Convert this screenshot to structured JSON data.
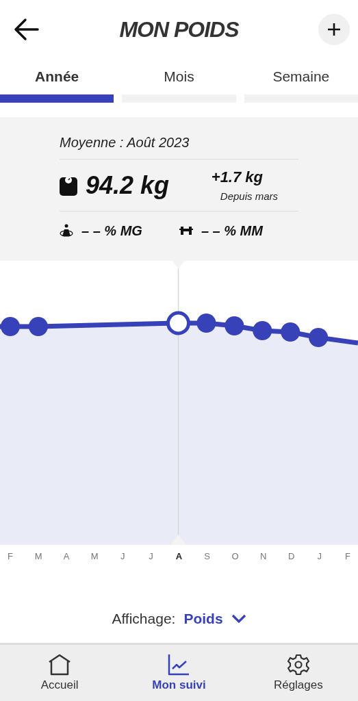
{
  "header": {
    "title": "MON POIDS"
  },
  "tabs": [
    {
      "label": "Année",
      "selected": true
    },
    {
      "label": "Mois",
      "selected": false
    },
    {
      "label": "Semaine",
      "selected": false
    }
  ],
  "summary": {
    "period": "Moyenne : Août 2023",
    "weight": "94.2 kg",
    "change": "+1.7 kg",
    "change_note": "Depuis mars",
    "fat": "– – % MG",
    "muscle": "– – % MM"
  },
  "chart": {
    "months": [
      {
        "label": "F",
        "selected": false
      },
      {
        "label": "M",
        "selected": false
      },
      {
        "label": "A",
        "selected": false
      },
      {
        "label": "M",
        "selected": false
      },
      {
        "label": "J",
        "selected": false
      },
      {
        "label": "J",
        "selected": false
      },
      {
        "label": "A",
        "selected": true
      },
      {
        "label": "S",
        "selected": false
      },
      {
        "label": "O",
        "selected": false
      },
      {
        "label": "N",
        "selected": false
      },
      {
        "label": "D",
        "selected": false
      },
      {
        "label": "J",
        "selected": false
      },
      {
        "label": "F",
        "selected": false
      }
    ]
  },
  "display": {
    "label": "Affichage:",
    "value": "Poids"
  },
  "nav": [
    {
      "kind": "home",
      "label": "Accueil",
      "selected": false
    },
    {
      "kind": "chart",
      "label": "Mon suivi",
      "selected": true
    },
    {
      "kind": "settings",
      "label": "Réglages",
      "selected": false
    }
  ]
}
